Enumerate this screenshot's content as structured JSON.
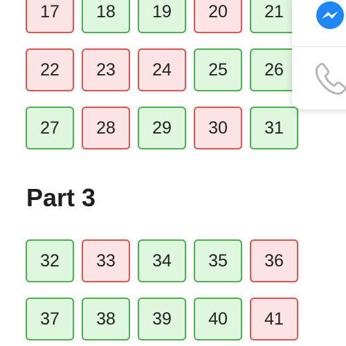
{
  "part2": {
    "cells": [
      {
        "number": "17",
        "status": "wrong"
      },
      {
        "number": "18",
        "status": "correct"
      },
      {
        "number": "19",
        "status": "correct"
      },
      {
        "number": "20",
        "status": "wrong"
      },
      {
        "number": "21",
        "status": "correct"
      },
      {
        "number": "22",
        "status": "wrong"
      },
      {
        "number": "23",
        "status": "wrong"
      },
      {
        "number": "24",
        "status": "wrong"
      },
      {
        "number": "25",
        "status": "correct"
      },
      {
        "number": "26",
        "status": "correct"
      },
      {
        "number": "27",
        "status": "correct"
      },
      {
        "number": "28",
        "status": "wrong"
      },
      {
        "number": "29",
        "status": "correct"
      },
      {
        "number": "30",
        "status": "wrong"
      },
      {
        "number": "31",
        "status": "correct"
      }
    ]
  },
  "part3": {
    "title": "Part 3",
    "cells": [
      {
        "number": "32",
        "status": "correct"
      },
      {
        "number": "33",
        "status": "wrong"
      },
      {
        "number": "34",
        "status": "correct"
      },
      {
        "number": "35",
        "status": "correct"
      },
      {
        "number": "36",
        "status": "wrong"
      },
      {
        "number": "37",
        "status": "correct"
      },
      {
        "number": "38",
        "status": "correct"
      },
      {
        "number": "39",
        "status": "correct"
      },
      {
        "number": "40",
        "status": "correct"
      },
      {
        "number": "41",
        "status": "wrong"
      }
    ]
  },
  "contact_panel": {
    "icons": [
      "messenger-icon",
      "phone-icon"
    ]
  },
  "colors": {
    "correct_fill": "#dff6df",
    "correct_border": "#4cae4c",
    "wrong_fill": "#fde4e4",
    "wrong_border": "#d9534f",
    "messenger": "#1f86f5",
    "phone": "#b5b5b5"
  }
}
